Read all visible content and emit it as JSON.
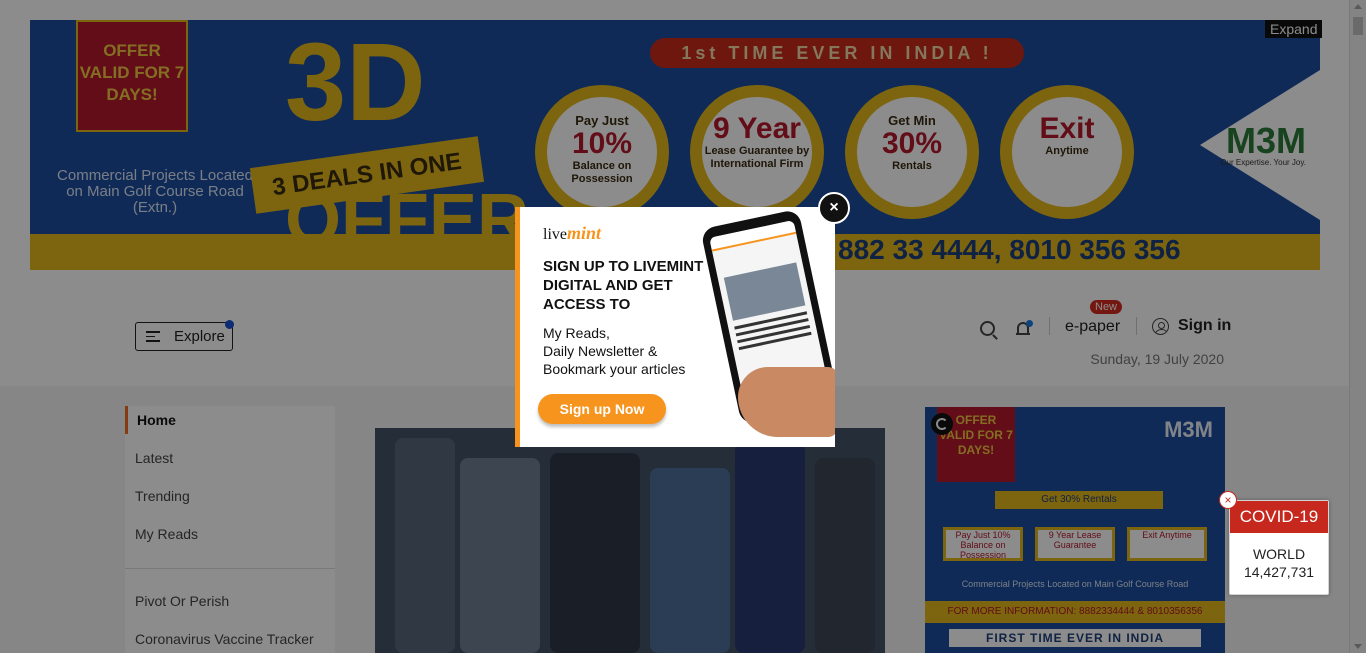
{
  "top_ad": {
    "offer": "OFFER VALID FOR 7 DAYS!",
    "commercial": "Commercial Projects Located on Main Golf Course Road (Extn.)",
    "big": "3D",
    "ribbon": "3 DEALS IN ONE",
    "offer_word": "OFFER",
    "first_time": "1st TIME EVER IN INDIA !",
    "circles": [
      {
        "l1": "Pay Just",
        "l2": "10%",
        "l3": "Balance on Possession"
      },
      {
        "l1": "",
        "l2": "9 Year",
        "l3": "Lease Guarantee by International Firm"
      },
      {
        "l1": "Get Min",
        "l2": "30%",
        "l3": "Rentals"
      },
      {
        "l1": "",
        "l2": "Exit",
        "l3": "Anytime"
      }
    ],
    "brand": "M3M",
    "tagline": "Our Expertise. Your Joy.",
    "phone": "882 33 4444, 8010 356 356",
    "expand_label": "Expand"
  },
  "header": {
    "explore_label": "Explore",
    "new_badge": "New",
    "epaper_label": "e-paper",
    "signin_label": "Sign in",
    "date": "Sunday, 19 July 2020"
  },
  "nav": {
    "items": [
      "Home",
      "Latest",
      "Trending",
      "My Reads"
    ],
    "secondary": [
      "Pivot Or Perish",
      "Coronavirus Vaccine Tracker"
    ]
  },
  "side_ad": {
    "offer": "OFFER VALID FOR 7 DAYS!",
    "brand": "M3M",
    "get": "Get 30% Rentals",
    "boxes": [
      "Pay Just 10% Balance on Possession",
      "9 Year Lease Guarantee",
      "Exit Anytime"
    ],
    "commercial": "Commercial Projects Located on Main Golf Course Road",
    "info": "FOR MORE INFORMATION: 8882334444 & 8010356356",
    "first_time": "FIRST TIME EVER IN INDIA"
  },
  "covid": {
    "title": "COVID-19",
    "world_label": "WORLD",
    "world_count": "14,427,731",
    "close": "×"
  },
  "modal": {
    "logo_prefix": "live",
    "logo_suffix": "mint",
    "headline": "SIGN UP TO LIVEMINT DIGITAL AND GET ACCESS TO",
    "benefits": [
      "My Reads,",
      "Daily Newsletter &",
      "Bookmark your articles"
    ],
    "cta": "Sign up Now",
    "close": "×"
  }
}
